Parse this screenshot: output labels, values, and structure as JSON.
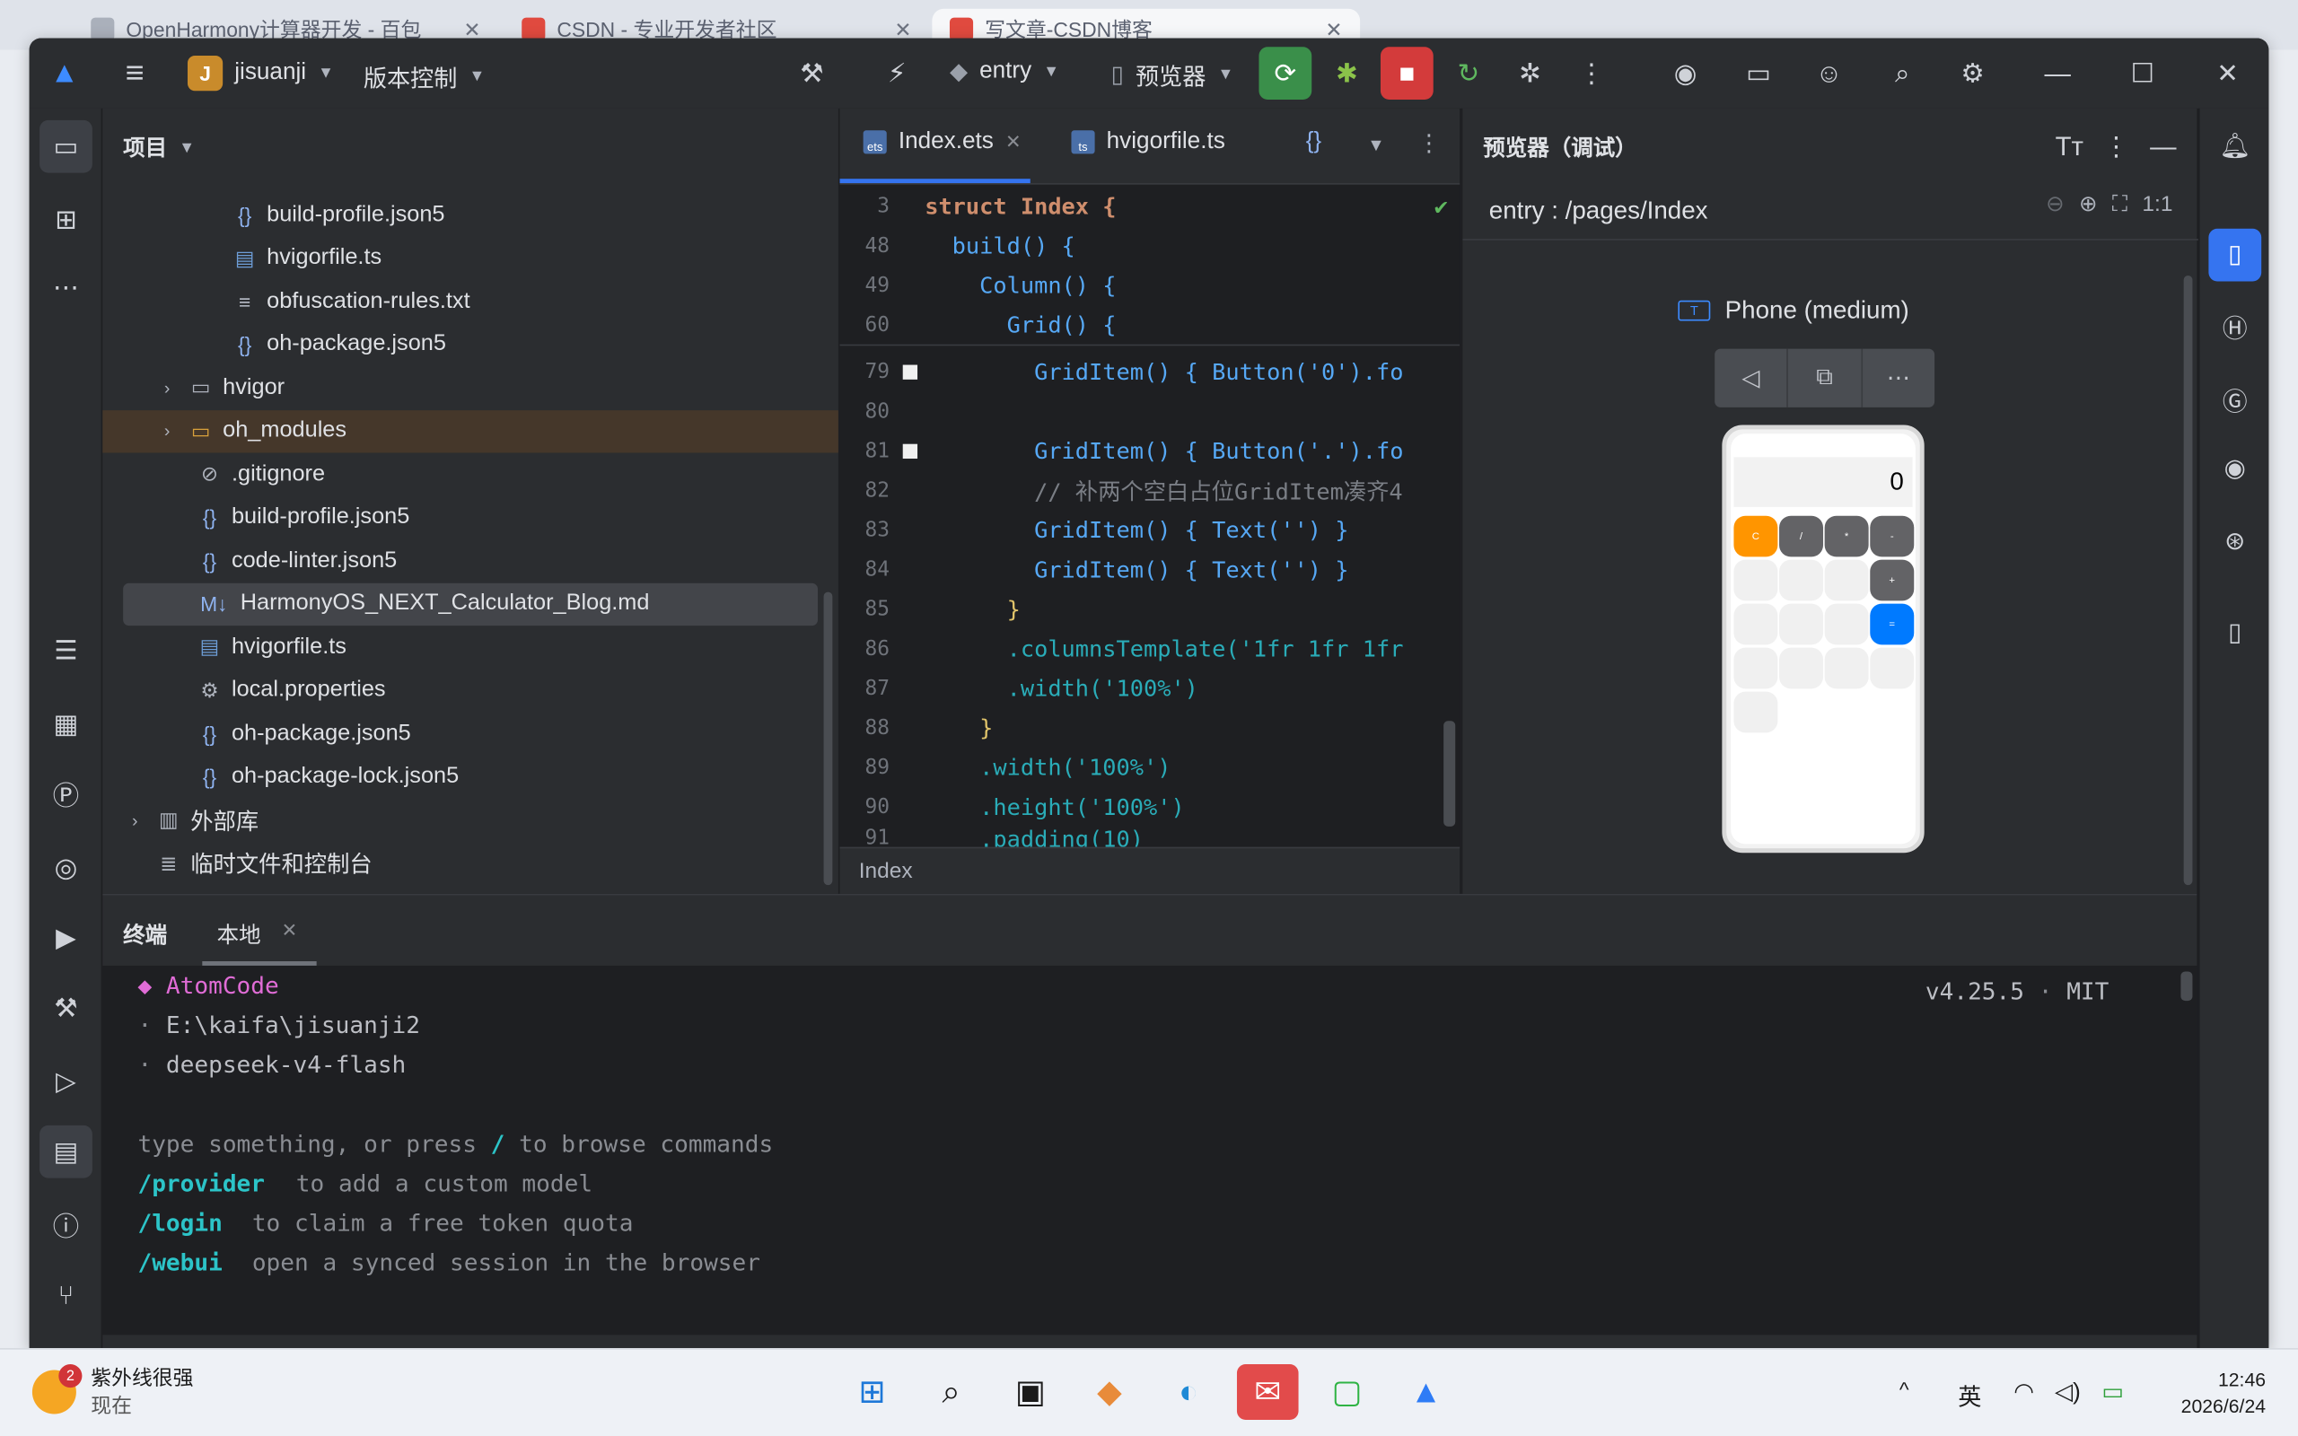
{
  "browser": {
    "tabs": [
      {
        "label": "OpenHarmony计算器开发 - 百包"
      },
      {
        "label": "CSDN - 专业开发者社区"
      },
      {
        "label": "写文章-CSDN博客"
      }
    ]
  },
  "toolbar": {
    "project_initial": "J",
    "project_name": "jisuanji",
    "vcs_label": "版本控制",
    "run_config": "entry",
    "device": "预览器"
  },
  "project_panel": {
    "title": "项目",
    "items": [
      {
        "label": "build-profile.json5",
        "icon": "json-icon"
      },
      {
        "label": "hvigorfile.ts",
        "icon": "ts-file-icon"
      },
      {
        "label": "obfuscation-rules.txt",
        "icon": "text-file-icon"
      },
      {
        "label": "oh-package.json5",
        "icon": "json-icon"
      },
      {
        "label": "hvigor",
        "icon": "folder-icon"
      },
      {
        "label": "oh_modules",
        "icon": "folder-icon"
      },
      {
        "label": ".gitignore",
        "icon": "ignore-icon"
      },
      {
        "label": "build-profile.json5",
        "icon": "json-icon"
      },
      {
        "label": "code-linter.json5",
        "icon": "json-icon"
      },
      {
        "label": "HarmonyOS_NEXT_Calculator_Blog.md",
        "icon": "markdown-icon"
      },
      {
        "label": "hvigorfile.ts",
        "icon": "ts-file-icon"
      },
      {
        "label": "local.properties",
        "icon": "settings-icon"
      },
      {
        "label": "oh-package.json5",
        "icon": "json-icon"
      },
      {
        "label": "oh-package-lock.json5",
        "icon": "json-icon"
      },
      {
        "label": "外部库",
        "icon": "library-icon"
      },
      {
        "label": "临时文件和控制台",
        "icon": "scratch-icon"
      }
    ]
  },
  "editor": {
    "tabs": [
      {
        "label": "Index.ets"
      },
      {
        "label": "hvigorfile.ts"
      }
    ],
    "sticky_lines": [
      {
        "num": "3",
        "code": "struct Index {"
      },
      {
        "num": "48",
        "code": "  build() {"
      },
      {
        "num": "49",
        "code": "    Column() {"
      },
      {
        "num": "60",
        "code": "      Grid() {"
      }
    ],
    "lines": [
      {
        "num": "79",
        "code": "        GridItem() { Button('0').fo"
      },
      {
        "num": "80",
        "code": ""
      },
      {
        "num": "81",
        "code": "        GridItem() { Button('.').fo"
      },
      {
        "num": "82",
        "code": "        // 补两个空白占位GridItem凑齐4"
      },
      {
        "num": "83",
        "code": "        GridItem() { Text('') }"
      },
      {
        "num": "84",
        "code": "        GridItem() { Text('') }"
      },
      {
        "num": "85",
        "code": "      }"
      },
      {
        "num": "86",
        "code": "      .columnsTemplate('1fr 1fr 1fr"
      },
      {
        "num": "87",
        "code": "      .width('100%')"
      },
      {
        "num": "88",
        "code": "    }"
      },
      {
        "num": "89",
        "code": "    .width('100%')"
      },
      {
        "num": "90",
        "code": "    .height('100%')"
      },
      {
        "num": "91",
        "code": "    .padding(10)"
      }
    ],
    "breadcrumb": "Index"
  },
  "preview": {
    "title": "预览器（调试）",
    "route": "entry : /pages/Index",
    "device_name": "Phone (medium)",
    "zoom_ratio": "1:1",
    "calculator": {
      "display": "0",
      "keys_row1": [
        "C",
        "/",
        "*",
        "-"
      ]
    }
  },
  "terminal": {
    "title": "终端",
    "tab": "本地",
    "app_name": "AtomCode",
    "path": "E:\\kaifa\\jisuanji2",
    "model": "deepseek-v4-flash",
    "version": "v4.25.5",
    "license": "MIT",
    "hint_prefix": "type something, or press ",
    "hint_slash": "/",
    "hint_suffix": " to browse commands",
    "commands": [
      {
        "cmd": "/provider",
        "desc": "to add a custom model"
      },
      {
        "cmd": "/login",
        "desc": "to claim a free token quota"
      },
      {
        "cmd": "/webui",
        "desc": "open a synced session in the browser"
      }
    ]
  },
  "taskbar": {
    "weather_badge": "2",
    "weather_text": "紫外线很强",
    "weather_sub": "现在",
    "ime": "英",
    "time": "12:46",
    "date": "2026/6/24"
  }
}
